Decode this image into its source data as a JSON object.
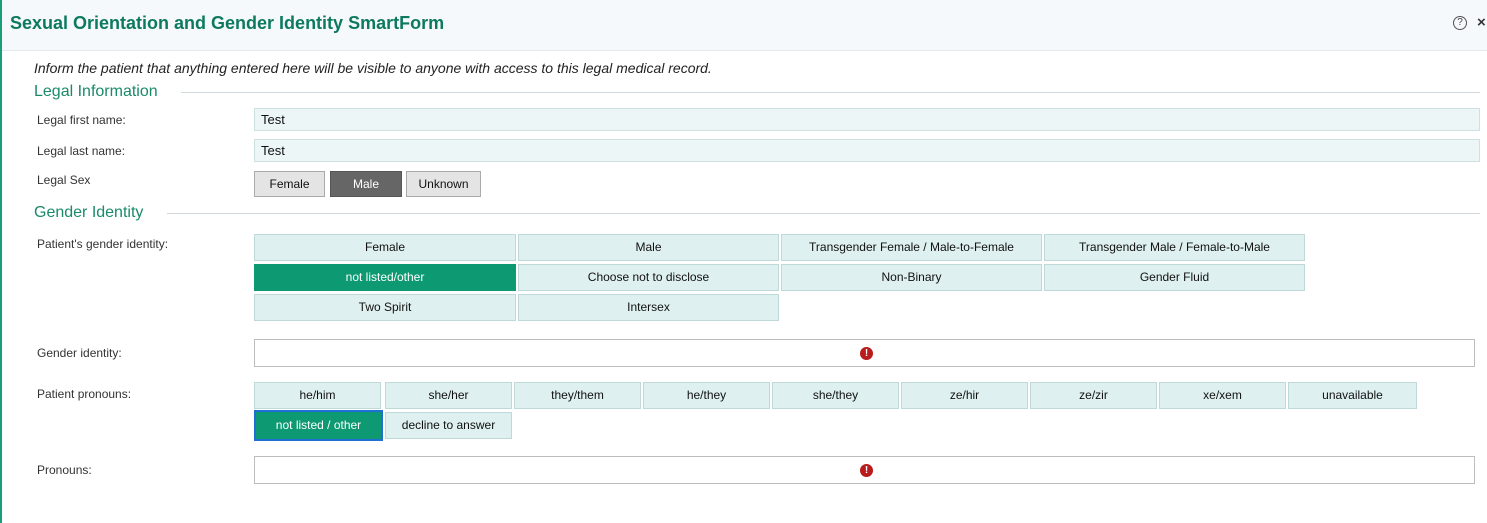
{
  "title": "Sexual Orientation and Gender Identity SmartForm",
  "icons": {
    "help": "?",
    "close": "×"
  },
  "info": "Inform the patient that anything entered here will be visible to anyone with access to this legal medical record.",
  "legal": {
    "heading": "Legal Information",
    "first_name_label": "Legal first name:",
    "first_name_value": "Test",
    "last_name_label": "Legal last name:",
    "last_name_value": "Test",
    "sex_label": "Legal Sex",
    "sex_options": [
      "Female",
      "Male",
      "Unknown"
    ],
    "sex_selected": "Male"
  },
  "gender": {
    "heading": "Gender Identity",
    "identity_label": "Patient's gender identity:",
    "identity_options": [
      "Female",
      "Male",
      "Transgender Female / Male-to-Female",
      "Transgender Male / Female-to-Male",
      "not listed/other",
      "Choose not to disclose",
      "Non-Binary",
      "Gender Fluid",
      "Two Spirit",
      "Intersex"
    ],
    "identity_selected": "not listed/other",
    "identity_text_label": "Gender identity:",
    "pronouns_label": "Patient pronouns:",
    "pronoun_options": [
      "he/him",
      "she/her",
      "they/them",
      "he/they",
      "she/they",
      "ze/hir",
      "ze/zir",
      "xe/xem",
      "unavailable",
      "not listed / other",
      "decline to answer"
    ],
    "pronoun_selected": "not listed / other",
    "pronouns_text_label": "Pronouns:"
  },
  "colors": {
    "accent": "#0d9a72",
    "heading": "#0d7a5f",
    "error": "#b81c1c"
  }
}
